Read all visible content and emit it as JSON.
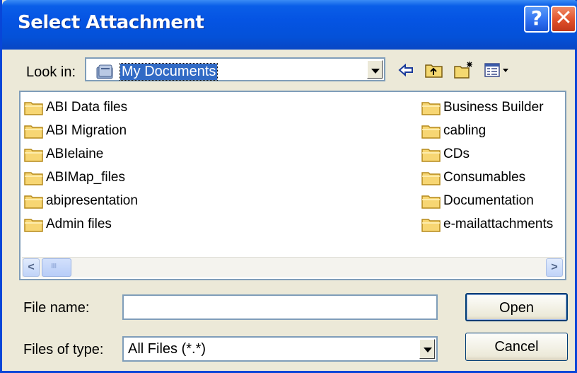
{
  "dialog": {
    "title": "Select Attachment",
    "help_label": "?",
    "close_label": "✕"
  },
  "lookin": {
    "label": "Look in:",
    "value": "My Documents"
  },
  "toolbar": {
    "icons": [
      "back-arrow-icon",
      "up-folder-icon",
      "new-folder-icon",
      "view-menu-icon"
    ]
  },
  "files": {
    "left": [
      "ABI Data files",
      "ABI Migration",
      "ABIelaine",
      "ABIMap_files",
      "abipresentation",
      "Admin files"
    ],
    "right": [
      "Business Builder",
      "cabling",
      "CDs",
      "Consumables",
      "Documentation",
      "e-mailattachments"
    ]
  },
  "filename": {
    "label": "File name:",
    "value": ""
  },
  "filetype": {
    "label": "Files of type:",
    "value": "All Files (*.*)"
  },
  "buttons": {
    "open": "Open",
    "cancel": "Cancel"
  },
  "colors": {
    "titlebar": "#0554e3",
    "dialog_bg": "#ece9d8",
    "selection": "#316ac5",
    "folder": "#f7d673"
  }
}
